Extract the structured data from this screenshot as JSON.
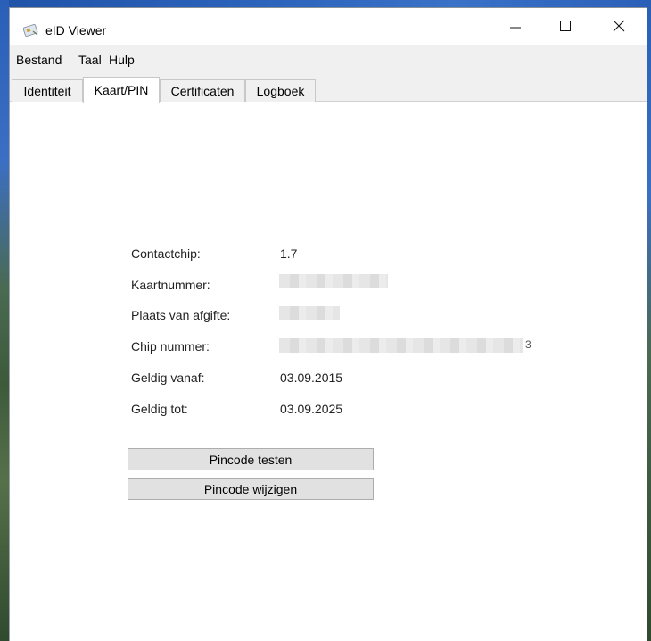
{
  "window": {
    "title": "eID Viewer",
    "app_icon": "eid-card-icon",
    "controls": {
      "minimize_icon": "minimize-icon",
      "maximize_icon": "maximize-icon",
      "close_icon": "close-icon"
    }
  },
  "menubar": {
    "items": [
      {
        "label": "Bestand"
      },
      {
        "label": "Taal"
      },
      {
        "label": "Hulp"
      }
    ]
  },
  "tabs": [
    {
      "label": "Identiteit",
      "active": false
    },
    {
      "label": "Kaart/PIN",
      "active": true
    },
    {
      "label": "Certificaten",
      "active": false
    },
    {
      "label": "Logboek",
      "active": false
    }
  ],
  "card_info": {
    "fields": [
      {
        "label": "Contactchip:",
        "value": "1.7"
      },
      {
        "label": "Kaartnummer:",
        "value": ""
      },
      {
        "label": "Plaats van afgifte:",
        "value": ""
      },
      {
        "label": "Chip nummer:",
        "value": ""
      },
      {
        "label": "Geldig vanaf:",
        "value": "03.09.2015"
      },
      {
        "label": "Geldig tot:",
        "value": "03.09.2025"
      }
    ],
    "chip_number_suffix": "3"
  },
  "actions": {
    "test_pin_label": "Pincode testen",
    "change_pin_label": "Pincode wijzigen"
  }
}
